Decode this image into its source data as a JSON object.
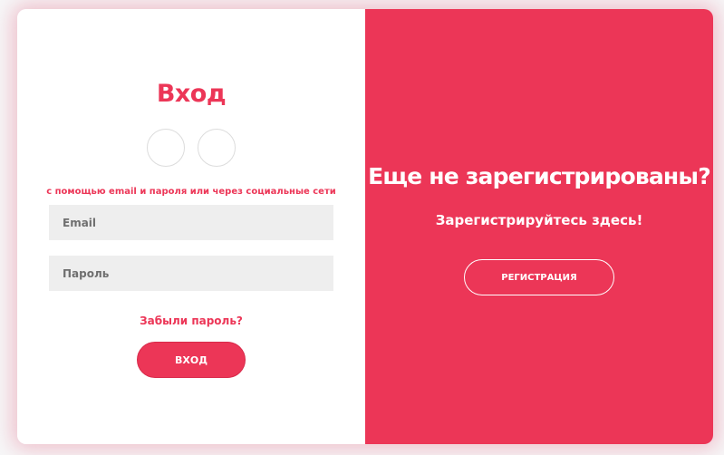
{
  "login": {
    "title": "Вход",
    "social_hint": "с помощью email и пароля или через социальные сети",
    "email_placeholder": "Email",
    "password_placeholder": "Пароль",
    "forgot_link": "Забыли пароль?",
    "submit_label": "ВХОД"
  },
  "promo": {
    "title": "Еще не зарегистрированы?",
    "subtitle": "Зарегистрируйтесь здесь!",
    "register_label": "РЕГИСТРАЦИЯ"
  },
  "colors": {
    "accent": "#ec3657",
    "field_bg": "#eeeeee",
    "white": "#ffffff"
  }
}
